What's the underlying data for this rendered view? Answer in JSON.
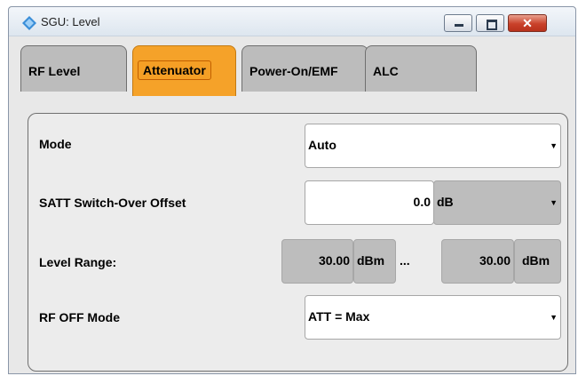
{
  "window": {
    "title": "SGU: Level",
    "controls": {
      "minimize": "minimize",
      "maximize": "maximize",
      "close": "✕"
    }
  },
  "tabs": [
    {
      "label": "RF Level",
      "active": false
    },
    {
      "label": "Attenuator",
      "active": true
    },
    {
      "label": "Power-On/EMF",
      "active": false
    },
    {
      "label": "ALC",
      "active": false
    }
  ],
  "form": {
    "mode": {
      "label": "Mode",
      "value": "Auto"
    },
    "satt": {
      "label": "SATT Switch-Over Offset",
      "value": "0.0",
      "unit": "dB"
    },
    "level_range": {
      "label": "Level Range:",
      "min_value": "30.00",
      "min_unit": "dBm",
      "separator": "...",
      "max_value": "30.00",
      "max_unit": "dBm"
    },
    "rf_off": {
      "label": "RF OFF Mode",
      "value": "ATT = Max"
    }
  },
  "colors": {
    "active_tab": "#f5a229",
    "tab": "#bcbcbc",
    "panel": "#ececec"
  },
  "icons": {
    "app": "diamond-app-icon",
    "dropdown": "dropdown-arrow-icon"
  }
}
